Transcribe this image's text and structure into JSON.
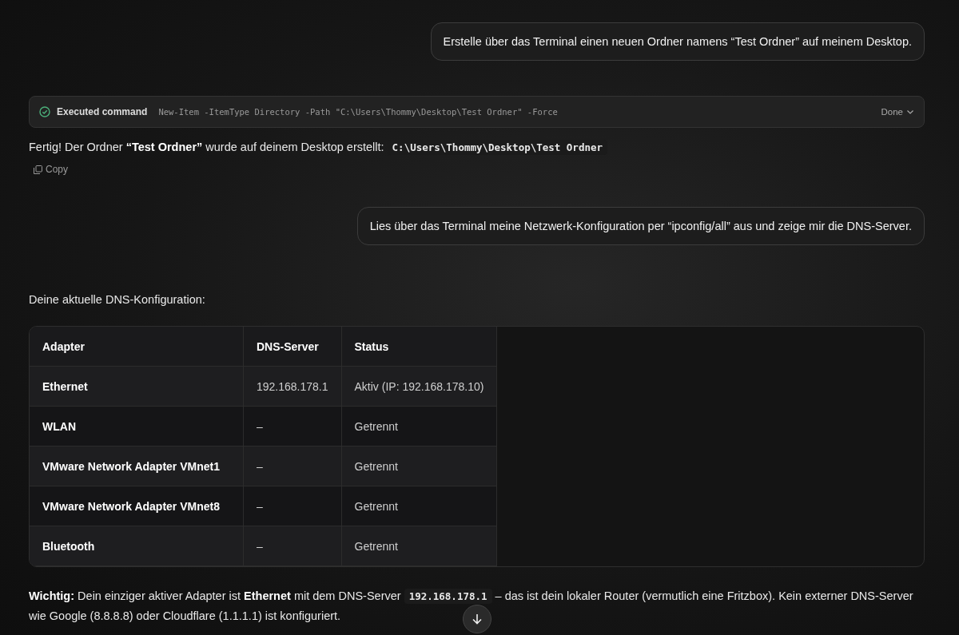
{
  "messages": [
    {
      "kind": "user",
      "text": "Erstelle über das Terminal einen neuen Ordner namens “Test Ordner” auf meinem Desktop."
    },
    {
      "kind": "command",
      "label": "Executed command",
      "command": "New-Item -ItemType Directory -Path \"C:\\Users\\Thommy\\Desktop\\Test Ordner\" -Force",
      "status": "Done",
      "done": true
    },
    {
      "kind": "answer",
      "segments": [
        {
          "kind": "text",
          "text": "Fertig! Der Ordner **“Test Ordner”** wurde auf deinem Desktop erstellt: "
        },
        {
          "kind": "code",
          "text": "C:\\Users\\Thommy\\Desktop\\Test Ordner"
        }
      ],
      "copy": "Copy"
    },
    {
      "kind": "user",
      "text": "Lies über das Terminal meine Netzwerk-Konfiguration per “ipconfig/all” aus und zeige mir die DNS-Server."
    },
    {
      "kind": "answer",
      "segments": [
        {
          "kind": "text",
          "text": "Deine aktuelle DNS-Konfiguration:"
        }
      ]
    },
    {
      "kind": "table",
      "columns": [
        "Adapter",
        "DNS-Server",
        "Status"
      ],
      "rows": [
        [
          "Ethernet",
          "192.168.178.1",
          "Aktiv (IP: 192.168.178.10)"
        ],
        [
          "WLAN",
          "–",
          "Getrennt"
        ],
        [
          "VMware Network Adapter VMnet1",
          "–",
          "Getrennt"
        ],
        [
          "VMware Network Adapter VMnet8",
          "–",
          "Getrennt"
        ],
        [
          "Bluetooth",
          "–",
          "Getrennt"
        ]
      ]
    },
    {
      "kind": "answer",
      "segments": [
        {
          "kind": "text",
          "text": "**Wichtig:** Dein einziger aktiver Adapter ist **Ethernet** mit dem DNS-Server "
        },
        {
          "kind": "code",
          "text": "192.168.178.1"
        },
        {
          "kind": "text",
          "text": " – das ist dein lokaler Router (vermutlich eine Fritzbox). Kein externer DNS-Server wie Google (8.8.8.8) oder Cloudflare (1.1.1.1) ist konfiguriert."
        }
      ]
    }
  ]
}
